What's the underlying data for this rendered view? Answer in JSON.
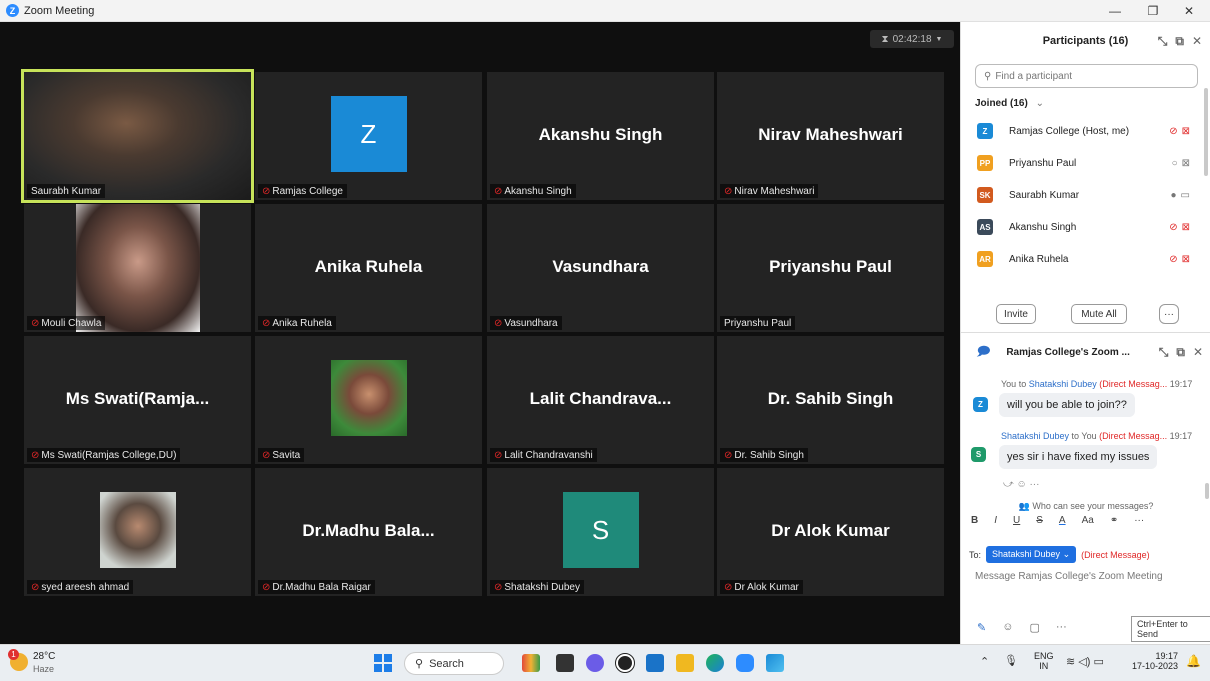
{
  "window": {
    "title": "Zoom Meeting",
    "minimize": "—",
    "restore": "❐",
    "close": "✕"
  },
  "timer": {
    "icon": "hourglass-icon",
    "text": "02:42:18"
  },
  "tiles": [
    {
      "label": "Saurabh Kumar",
      "kind": "video",
      "muted": false,
      "active": true
    },
    {
      "label": "Ramjas College",
      "kind": "avatar",
      "avatar_letter": "Z",
      "avatar_color": "#1a8ad6",
      "muted": true
    },
    {
      "label": "Akanshu Singh",
      "kind": "name",
      "big": "Akanshu Singh",
      "muted": true
    },
    {
      "label": "Nirav Maheshwari",
      "kind": "name",
      "big": "Nirav Maheshwari",
      "muted": true
    },
    {
      "label": "Mouli Chawla",
      "kind": "video",
      "muted": true
    },
    {
      "label": "Anika Ruhela",
      "kind": "name",
      "big": "Anika Ruhela",
      "muted": true
    },
    {
      "label": "Vasundhara",
      "kind": "name",
      "big": "Vasundhara",
      "muted": true
    },
    {
      "label": "Priyanshu Paul",
      "kind": "name",
      "big": "Priyanshu Paul",
      "muted": false
    },
    {
      "label": "Ms Swati(Ramjas College,DU)",
      "kind": "name",
      "big": "Ms  Swati(Ramja...",
      "muted": true
    },
    {
      "label": "Savita",
      "kind": "photo",
      "muted": true
    },
    {
      "label": "Lalit Chandravanshi",
      "kind": "name",
      "big": "Lalit  Chandrava...",
      "muted": true
    },
    {
      "label": "Dr. Sahib Singh",
      "kind": "name",
      "big": "Dr. Sahib Singh",
      "muted": true
    },
    {
      "label": "syed areesh ahmad",
      "kind": "photo",
      "muted": true
    },
    {
      "label": "Dr.Madhu Bala Raigar",
      "kind": "name",
      "big": "Dr.Madhu  Bala...",
      "muted": true
    },
    {
      "label": "Shatakshi Dubey",
      "kind": "avatar",
      "avatar_letter": "S",
      "avatar_color": "#1f8a7a",
      "muted": true
    },
    {
      "label": "Dr Alok Kumar",
      "kind": "name",
      "big": "Dr Alok Kumar",
      "muted": true
    }
  ],
  "participants": {
    "title": "Participants (16)",
    "search_placeholder": "Find a participant",
    "joined_label": "Joined (16)",
    "list": [
      {
        "initials": "Z",
        "name": "Ramjas College (Host, me)",
        "color": "#1a8ad6",
        "status": "muted"
      },
      {
        "initials": "PP",
        "name": "Priyanshu Paul",
        "color": "#f0a020",
        "status": "mic-on"
      },
      {
        "initials": "SK",
        "name": "Saurabh Kumar",
        "color": "#d25a1e",
        "status": "talking"
      },
      {
        "initials": "AS",
        "name": "Akanshu Singh",
        "color": "#3b4a5a",
        "status": "muted"
      },
      {
        "initials": "AR",
        "name": "Anika Ruhela",
        "color": "#f0a020",
        "status": "muted"
      }
    ],
    "invite_label": "Invite",
    "mute_all_label": "Mute All",
    "more_label": "···"
  },
  "chat": {
    "title": "Ramjas College's Zoom ...",
    "messages": [
      {
        "from": "You",
        "to": "Shatakshi Dubey",
        "dm": "(Direct Messag...",
        "time": "19:17",
        "text": "will you be able to join??",
        "initials": "Z",
        "color": "#1a8ad6"
      },
      {
        "from": "Shatakshi Dubey",
        "to": "You",
        "dm": "(Direct Messag...",
        "time": "19:17",
        "text": "yes sir i have fixed my issues",
        "initials": "S",
        "color": "#1f9a6a"
      }
    ],
    "who_can_see": "Who can see your messages?",
    "to_label": "To:",
    "recipient": "Shatakshi Dubey",
    "dm_label": "(Direct Message)",
    "placeholder": "Message Ramjas College's Zoom Meeting",
    "send_tooltip": "Ctrl+Enter to Send"
  },
  "taskbar": {
    "weather_temp": "28°C",
    "weather_desc": "Haze",
    "weather_badge": "1",
    "search_label": "Search",
    "lang1": "ENG",
    "lang2": "IN",
    "time": "19:17",
    "date": "17-10-2023"
  }
}
